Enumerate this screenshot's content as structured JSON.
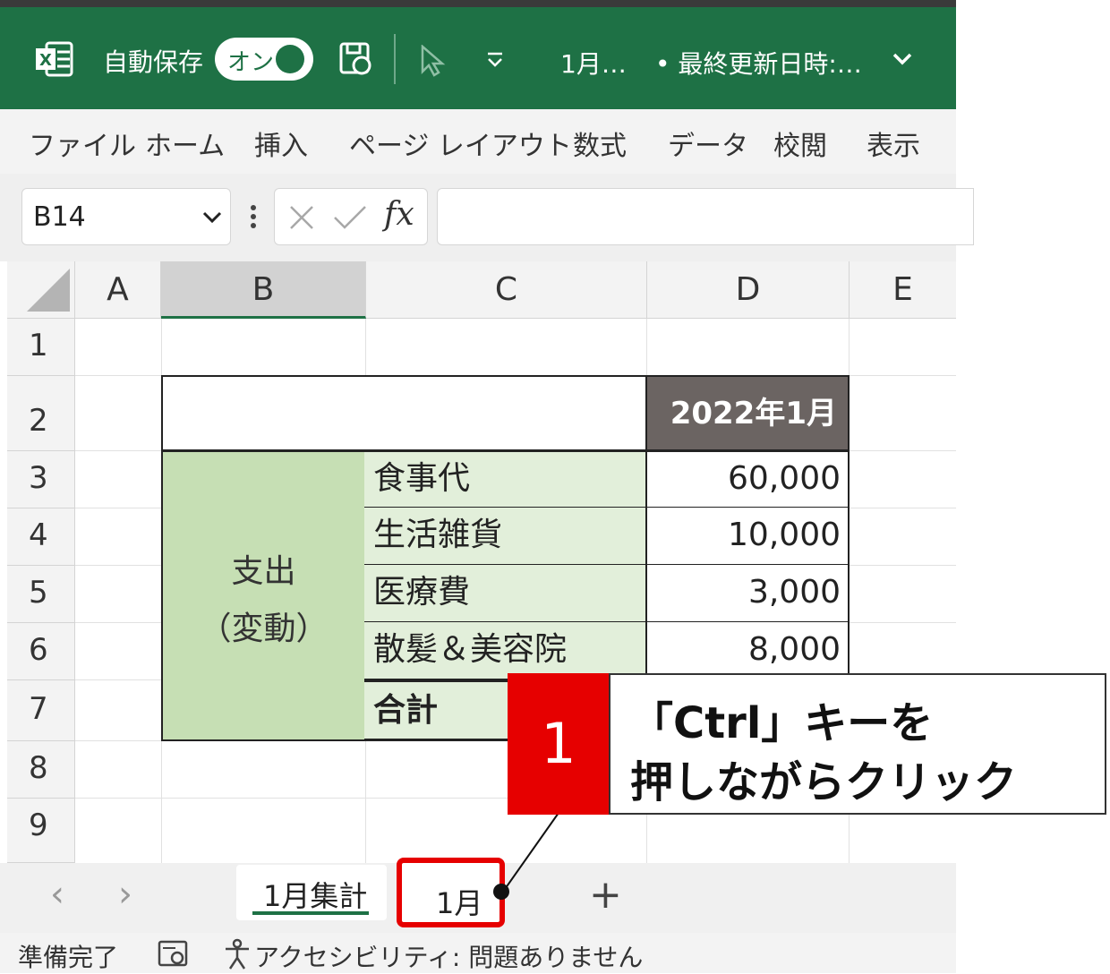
{
  "titlebar": {
    "autosave_label": "自動保存",
    "toggle_label": "オン",
    "filename": "1月…",
    "modified": "• 最終更新日時:…",
    "icons": [
      "excel-logo-icon",
      "save-icon",
      "cursor-icon",
      "qat-dropdown-icon",
      "title-chevron-icon"
    ]
  },
  "ribbon": {
    "tabs": [
      "ファイル",
      "ホーム",
      "挿入",
      "ページ レイアウト",
      "数式",
      "データ",
      "校閲",
      "表示"
    ]
  },
  "formula_bar": {
    "name_box": "B14",
    "fx": "fx",
    "formula": ""
  },
  "grid": {
    "columns": [
      "A",
      "B",
      "C",
      "D",
      "E"
    ],
    "rows": [
      "1",
      "2",
      "3",
      "4",
      "5",
      "6",
      "7",
      "8",
      "9"
    ],
    "header_cell": "2022年1月",
    "group_label_1": "支出",
    "group_label_2": "（変動）",
    "items": [
      {
        "name": "食事代",
        "value": "60,000"
      },
      {
        "name": "生活雑貨",
        "value": "10,000"
      },
      {
        "name": "医療費",
        "value": "3,000"
      },
      {
        "name": "散髪＆美容院",
        "value": "8,000"
      }
    ],
    "total_label": "合計"
  },
  "sheet_tabs": {
    "prev": "‹",
    "next": "›",
    "tabs": [
      "1月集計",
      "1月"
    ],
    "add": "+"
  },
  "status_bar": {
    "ready": "準備完了",
    "accessibility": "アクセシビリティ: 問題ありません"
  },
  "callout": {
    "step": "1",
    "line1": "「Ctrl」キーを",
    "line2": "押しながらクリック"
  },
  "colors": {
    "excel_green": "#1e7145",
    "header_dark": "#6b6462",
    "group_fill": "#c6dfb4",
    "item_fill": "#e2efda",
    "highlight_red": "#e60000"
  }
}
